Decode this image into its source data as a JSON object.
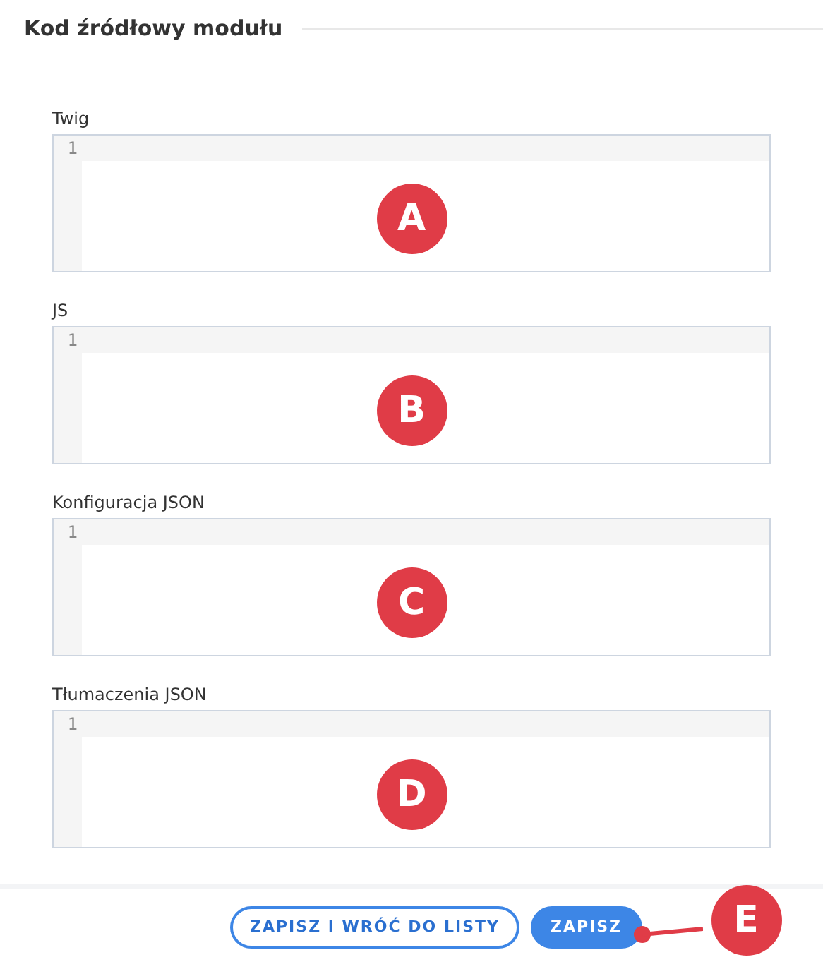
{
  "section": {
    "title": "Kod źródłowy modułu"
  },
  "editors": [
    {
      "label": "Twig",
      "line_number": "1",
      "callout": "A"
    },
    {
      "label": "JS",
      "line_number": "1",
      "callout": "B"
    },
    {
      "label": "Konfiguracja JSON",
      "line_number": "1",
      "callout": "C"
    },
    {
      "label": "Tłumaczenia JSON",
      "line_number": "1",
      "callout": "D"
    }
  ],
  "footer": {
    "buttons": [
      {
        "label": "ZAPISZ I WRÓĆ DO LISTY",
        "kind": "outline"
      },
      {
        "label": "ZAPISZ",
        "kind": "primary"
      }
    ],
    "callout": "E"
  }
}
